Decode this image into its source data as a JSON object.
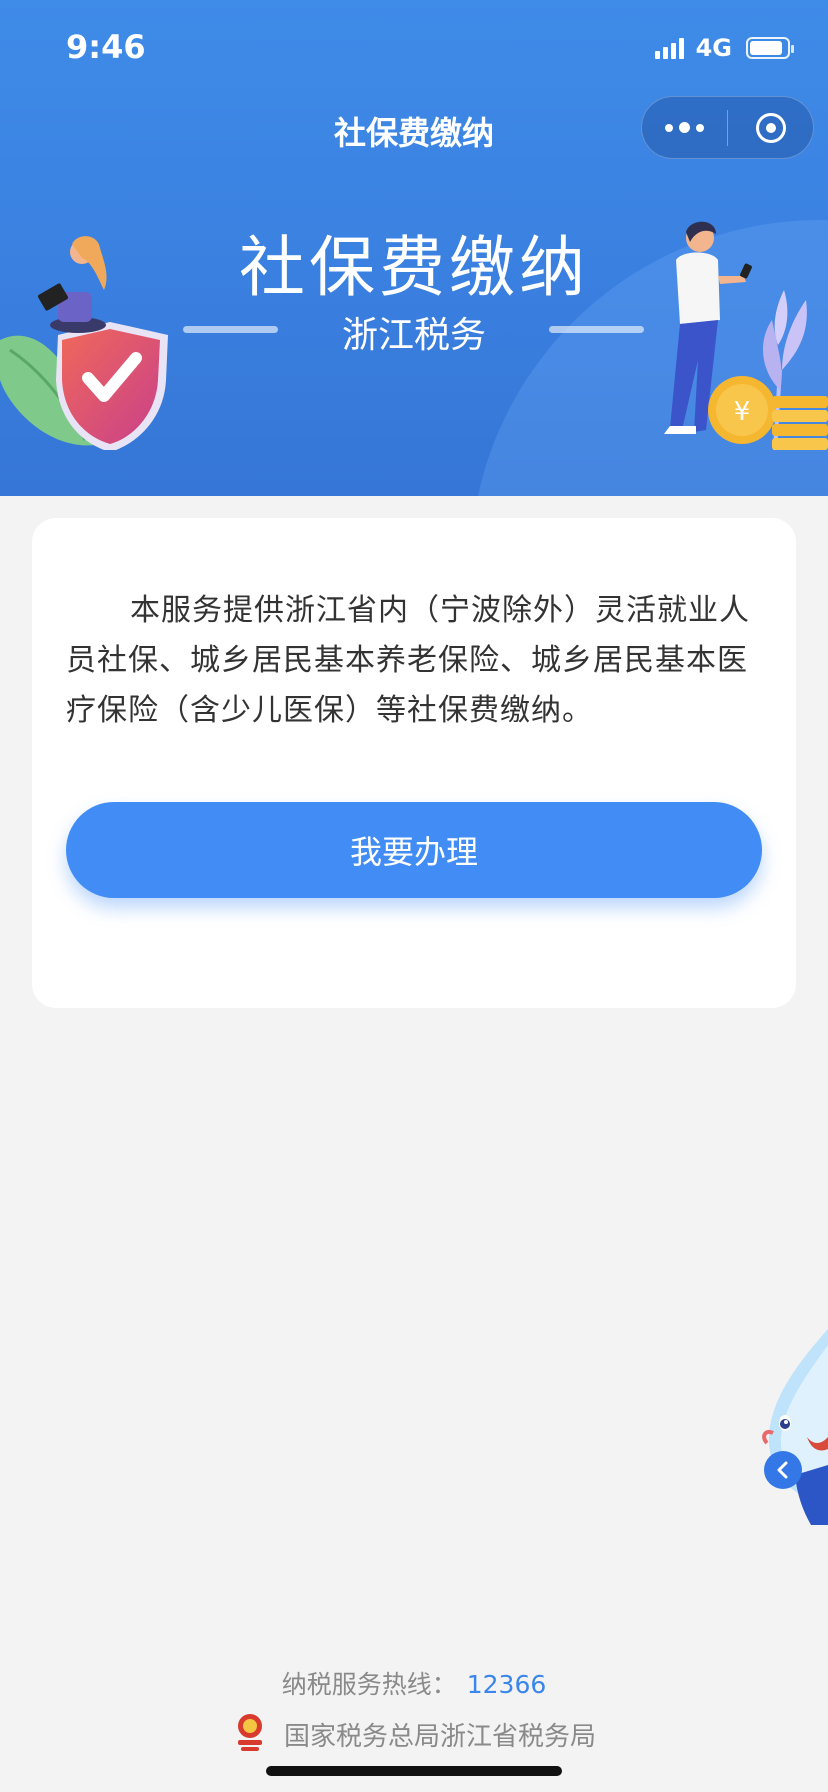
{
  "status_bar": {
    "time": "9:46",
    "network": "4G"
  },
  "nav": {
    "title": "社保费缴纳"
  },
  "banner": {
    "title": "社保费缴纳",
    "subtitle": "浙江税务"
  },
  "card": {
    "description": "本服务提供浙江省内（宁波除外）灵活就业人员社保、城乡居民基本养老保险、城乡居民基本医疗保险（含少儿医保）等社保费缴纳。",
    "action_label": "我要办理"
  },
  "footer": {
    "hotline_label": "纳税服务热线：",
    "hotline_number": "12366",
    "organization": "国家税务总局浙江省税务局"
  },
  "colors": {
    "primary": "#418cf5",
    "header": "#3f8be8",
    "background": "#f3f3f3"
  }
}
